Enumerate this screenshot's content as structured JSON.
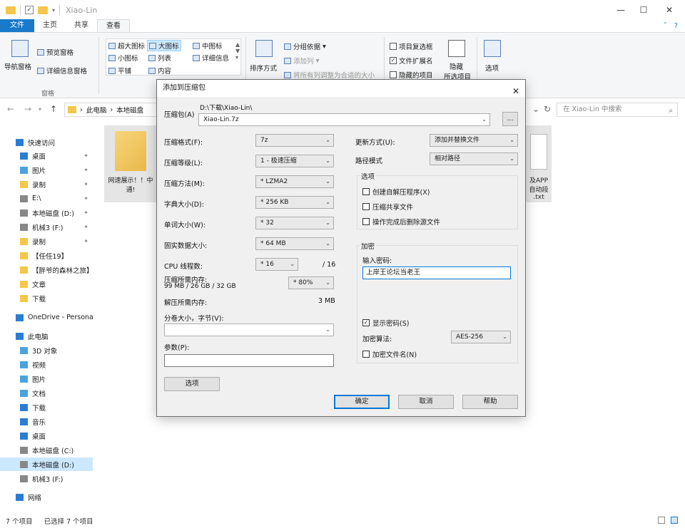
{
  "window": {
    "title": "Xiao-Lin"
  },
  "ribbon": {
    "tabs": [
      {
        "label": "文件"
      },
      {
        "label": "主页"
      },
      {
        "label": "共享"
      },
      {
        "label": "查看"
      }
    ],
    "pane": {
      "nav_pane": "导航窗格",
      "preview": "预览窗格",
      "details": "详细信息窗格",
      "group_label": "窗格"
    },
    "layout": {
      "extra_large": "超大图标",
      "large": "大图标",
      "medium": "中图标",
      "small": "小图标",
      "list": "列表",
      "details": "详细信息",
      "tiles": "平铺",
      "content": "内容"
    },
    "view": {
      "sort": "排序方式",
      "group": "分组依据",
      "add_column": "添加列",
      "fit_columns": "将所有列调整为合适的大小"
    },
    "show": {
      "item_checkbox": "项目复选框",
      "file_ext": "文件扩展名",
      "hidden_items": "隐藏的项目",
      "hide": "隐藏",
      "hide_selected": "所选项目",
      "options": "选项"
    }
  },
  "address": {
    "path": [
      "此电脑",
      "本地磁盘"
    ],
    "search_placeholder": "在 Xiao-Lin 中搜索"
  },
  "nav": {
    "items": [
      {
        "label": "快速访问",
        "icon": "star-icon",
        "color": "#2b7cd3"
      },
      {
        "label": "桌面",
        "icon": "desktop-icon",
        "color": "#2b7cd3",
        "pinned": true
      },
      {
        "label": "图片",
        "icon": "pictures-icon",
        "color": "#4aa3df",
        "pinned": true
      },
      {
        "label": "录制",
        "icon": "folder-icon",
        "color": "#f4c64a",
        "pinned": true
      },
      {
        "label": "E:\\",
        "icon": "drive-icon",
        "color": "#888888",
        "pinned": true
      },
      {
        "label": "本地磁盘 (D:)",
        "icon": "drive-icon",
        "color": "#888888",
        "pinned": true
      },
      {
        "label": "机械3 (F:)",
        "icon": "drive-icon",
        "color": "#888888",
        "pinned": true
      },
      {
        "label": "录制",
        "icon": "folder-icon",
        "color": "#f4c64a",
        "pinned": true
      },
      {
        "label": "【任任19】",
        "icon": "folder-icon",
        "color": "#f4c64a"
      },
      {
        "label": "【胖爷的森林之旅】",
        "icon": "folder-icon",
        "color": "#f4c64a"
      },
      {
        "label": "文章",
        "icon": "folder-icon",
        "color": "#f4c64a"
      },
      {
        "label": "下载",
        "icon": "folder-icon",
        "color": "#f4c64a"
      },
      {
        "label": "OneDrive - Persona",
        "icon": "cloud-icon",
        "color": "#2b7cd3"
      },
      {
        "label": "此电脑",
        "icon": "computer-icon",
        "color": "#2b7cd3"
      },
      {
        "label": "3D 对象",
        "icon": "cube-icon",
        "color": "#4aa3df"
      },
      {
        "label": "视频",
        "icon": "video-icon",
        "color": "#4aa3df"
      },
      {
        "label": "图片",
        "icon": "pictures-icon",
        "color": "#4aa3df"
      },
      {
        "label": "文档",
        "icon": "document-icon",
        "color": "#4aa3df"
      },
      {
        "label": "下载",
        "icon": "download-icon",
        "color": "#2b7cd3"
      },
      {
        "label": "音乐",
        "icon": "music-icon",
        "color": "#2b7cd3"
      },
      {
        "label": "桌面",
        "icon": "desktop-icon",
        "color": "#2b7cd3"
      },
      {
        "label": "本地磁盘 (C:)",
        "icon": "drive-icon",
        "color": "#888888"
      },
      {
        "label": "本地磁盘 (D:)",
        "icon": "drive-icon",
        "color": "#888888",
        "selected": true
      },
      {
        "label": "机械3 (F:)",
        "icon": "drive-icon",
        "color": "#888888"
      },
      {
        "label": "网络",
        "icon": "network-icon",
        "color": "#2b7cd3"
      }
    ]
  },
  "files": {
    "left_tile": {
      "line1": "网速展示！！中",
      "line2": "通!"
    },
    "right_tile": {
      "line1": "及APP",
      "line2": "自动段",
      "line3": ".txt"
    }
  },
  "status": {
    "count": "7 个项目",
    "selected": "已选择 7 个项目"
  },
  "dialog": {
    "title": "添加到压缩包",
    "archive_label": "压缩包(A)",
    "archive_dir": "D:\\下载\\Xiao-Lin\\",
    "archive_name": "Xiao-Lin.7z",
    "browse": "...",
    "format_label": "压缩格式(F):",
    "format_value": "7z",
    "level_label": "压缩等级(L):",
    "level_value": "1 - 极速压缩",
    "method_label": "压缩方法(M):",
    "method_value": "* LZMA2",
    "dict_label": "字典大小(D):",
    "dict_value": "* 256 KB",
    "word_label": "单词大小(W):",
    "word_value": "* 32",
    "solid_label": "固实数据大小:",
    "solid_value": "* 64 MB",
    "threads_label": "CPU 线程数:",
    "threads_value": "* 16",
    "threads_max": "/ 16",
    "mem_comp_label": "压缩所需内存:",
    "mem_comp_value": "99 MB / 26 GB / 32 GB",
    "mem_pct": "* 80%",
    "mem_decomp_label": "解压所需内存:",
    "mem_decomp_value": "3 MB",
    "split_label": "分卷大小，字节(V):",
    "params_label": "参数(P):",
    "options_btn": "选项",
    "update_label": "更新方式(U):",
    "update_value": "添加并替换文件",
    "path_label": "路径模式",
    "path_value": "相对路径",
    "opt_group": "选项",
    "opt_sfx": "创建自解压程序(X)",
    "opt_shared": "压缩共享文件",
    "opt_delete": "操作完成后删除源文件",
    "enc_group": "加密",
    "pwd_label": "输入密码:",
    "pwd_value": "上岸王论坛当老王",
    "show_pwd": "显示密码(S)",
    "enc_method_label": "加密算法:",
    "enc_method_value": "AES-256",
    "enc_names": "加密文件名(N)",
    "ok": "确定",
    "cancel": "取消",
    "help": "帮助"
  }
}
